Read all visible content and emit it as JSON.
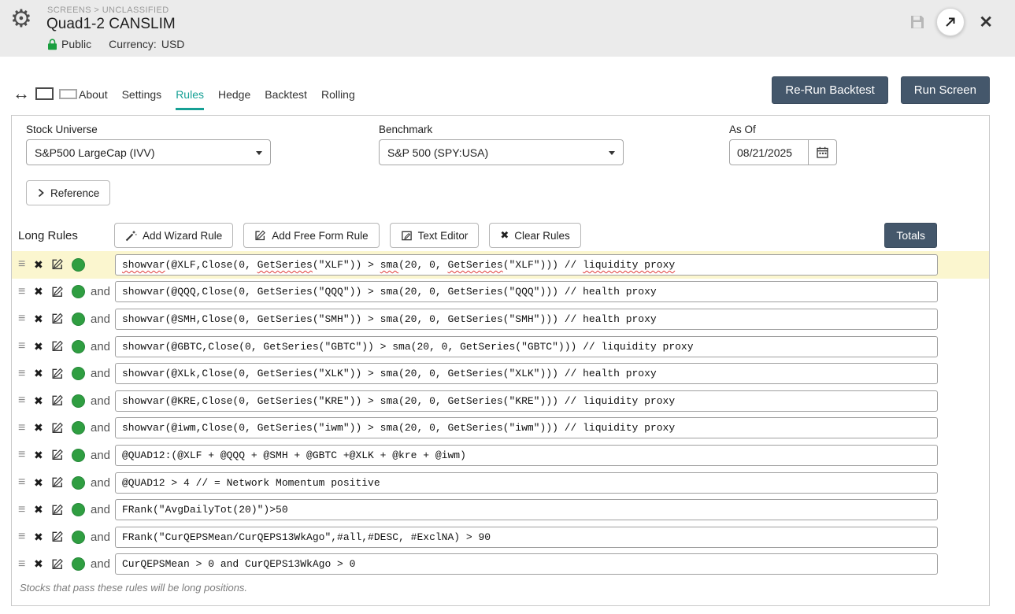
{
  "header": {
    "breadcrumb": "SCREENS > UNCLASSIFIED",
    "title": "Quad1-2 CANSLIM",
    "visibility": "Public",
    "currency_label": "Currency:",
    "currency_value": "USD"
  },
  "icons": {
    "gear": "⚙",
    "resize": "↔",
    "close": "✕",
    "drag_handle": "≡",
    "delete_rule": "✖",
    "clear": "✖"
  },
  "tabs": {
    "active": "Rules",
    "items": [
      "About",
      "Settings",
      "Rules",
      "Hedge",
      "Backtest",
      "Rolling"
    ]
  },
  "top_actions": {
    "rerun_backtest": "Re-Run Backtest",
    "run_screen": "Run Screen"
  },
  "filters": {
    "stock_universe": {
      "label": "Stock Universe",
      "value": "S&P500 LargeCap (IVV)"
    },
    "benchmark": {
      "label": "Benchmark",
      "value": "S&P 500 (SPY:USA)"
    },
    "as_of": {
      "label": "As Of",
      "value": "08/21/2025"
    }
  },
  "reference_label": "Reference",
  "long_rules": {
    "label": "Long Rules",
    "connector": "and",
    "buttons": {
      "add_wizard": "Add Wizard Rule",
      "add_freeform": "Add Free Form Rule",
      "text_editor": "Text Editor",
      "clear_rules": "Clear Rules",
      "totals": "Totals"
    },
    "rules": [
      {
        "and": false,
        "highlight": true,
        "segments": [
          {
            "text": "showvar",
            "misspelled": true
          },
          {
            "text": "(@XLF,Close(0, ",
            "misspelled": false
          },
          {
            "text": "GetSeries",
            "misspelled": true
          },
          {
            "text": "(\"XLF\")) > ",
            "misspelled": false
          },
          {
            "text": "sma",
            "misspelled": true
          },
          {
            "text": "(20, 0, ",
            "misspelled": false
          },
          {
            "text": "GetSeries",
            "misspelled": true
          },
          {
            "text": "(\"XLF\"))) // ",
            "misspelled": false
          },
          {
            "text": "liquidity proxy",
            "misspelled": true
          }
        ]
      },
      {
        "and": true,
        "text": "showvar(@QQQ,Close(0, GetSeries(\"QQQ\")) > sma(20, 0, GetSeries(\"QQQ\"))) // health proxy"
      },
      {
        "and": true,
        "text": "showvar(@SMH,Close(0, GetSeries(\"SMH\")) > sma(20, 0, GetSeries(\"SMH\"))) // health proxy"
      },
      {
        "and": true,
        "text": "showvar(@GBTC,Close(0, GetSeries(\"GBTC\")) > sma(20, 0, GetSeries(\"GBTC\"))) // liquidity proxy"
      },
      {
        "and": true,
        "text": "showvar(@XLk,Close(0, GetSeries(\"XLK\")) > sma(20, 0, GetSeries(\"XLK\"))) // health proxy"
      },
      {
        "and": true,
        "text": "showvar(@KRE,Close(0, GetSeries(\"KRE\")) > sma(20, 0, GetSeries(\"KRE\"))) // liquidity proxy"
      },
      {
        "and": true,
        "text": "showvar(@iwm,Close(0, GetSeries(\"iwm\")) > sma(20, 0, GetSeries(\"iwm\"))) // liquidity proxy"
      },
      {
        "and": true,
        "text": "@QUAD12:(@XLF + @QQQ + @SMH + @GBTC +@XLK + @kre + @iwm)"
      },
      {
        "and": true,
        "text": "@QUAD12 > 4 // = Network Momentum positive"
      },
      {
        "and": true,
        "text": "FRank(\"AvgDailyTot(20)\")>50"
      },
      {
        "and": true,
        "text": "FRank(\"CurQEPSMean/CurQEPS13WkAgo\",#all,#DESC, #ExclNA) > 90"
      },
      {
        "and": true,
        "text": "CurQEPSMean > 0 and CurQEPS13WkAgo > 0"
      }
    ],
    "footnote": "Stocks that pass these rules will be long positions."
  },
  "colors": {
    "header_bg": "#ebebeb",
    "accent_teal": "#16a095",
    "dark_button": "#44576b",
    "rule_highlight": "#fbf6cf",
    "enabled_green": "#2f9e41",
    "misspell_red": "#e03c3c"
  }
}
